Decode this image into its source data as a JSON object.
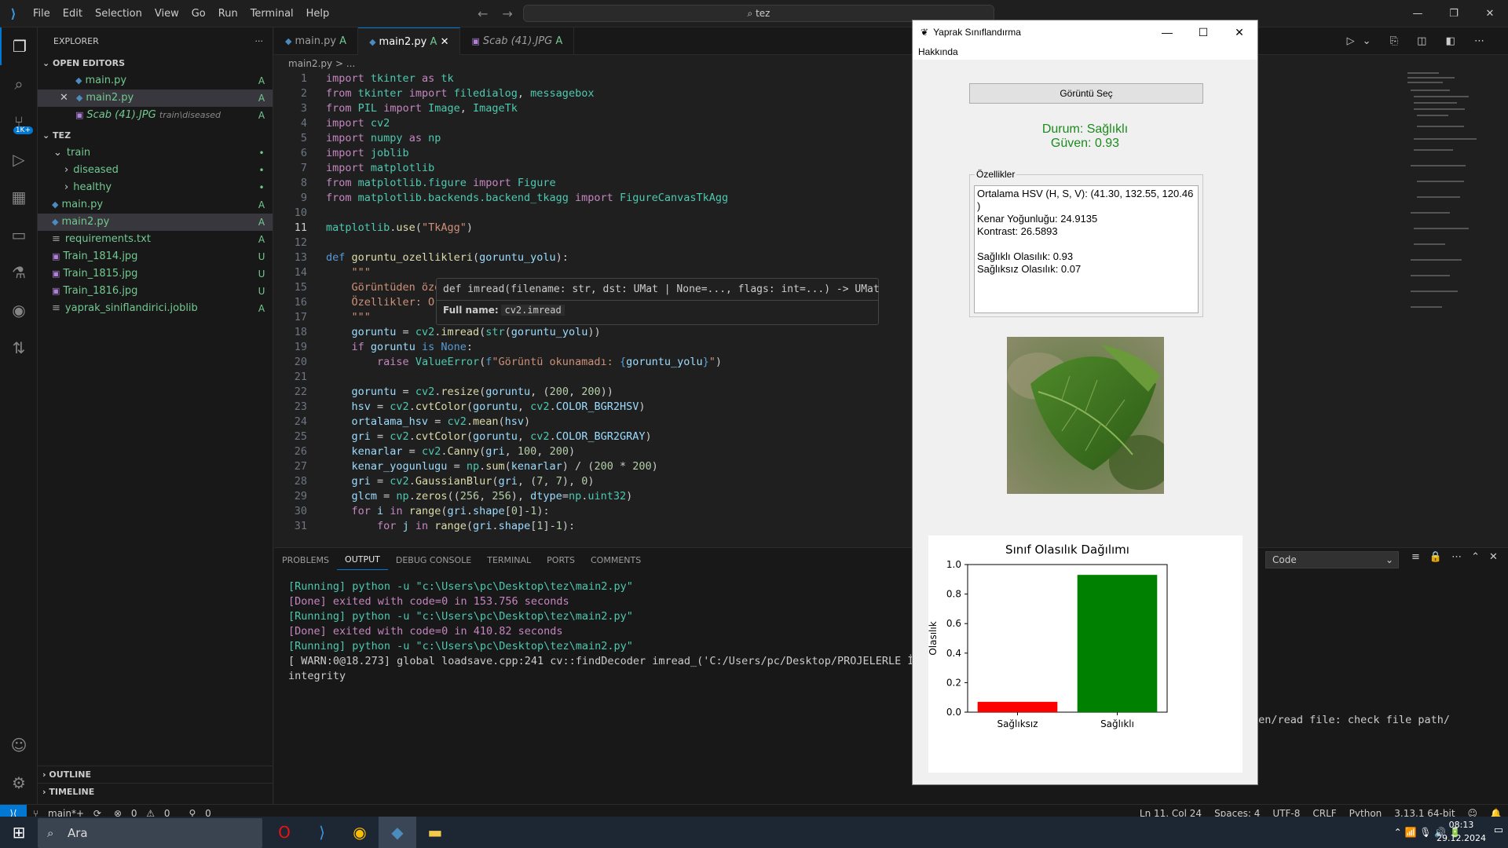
{
  "menu": [
    "File",
    "Edit",
    "Selection",
    "View",
    "Go",
    "Run",
    "Terminal",
    "Help"
  ],
  "search": "tez",
  "explorer": {
    "title": "EXPLORER",
    "open_editors": "OPEN EDITORS",
    "folder": "TEZ",
    "outline": "OUTLINE",
    "timeline": "TIMELINE",
    "open": [
      {
        "name": "main.py",
        "st": "A"
      },
      {
        "name": "main2.py",
        "st": "A"
      },
      {
        "name": "Scab (41).JPG",
        "path": "train\\diseased",
        "st": "A"
      }
    ],
    "tree": [
      {
        "name": "train",
        "st": "•"
      },
      {
        "name": "diseased",
        "st": "•"
      },
      {
        "name": "healthy",
        "st": "•"
      },
      {
        "name": "main.py",
        "st": "A"
      },
      {
        "name": "main2.py",
        "st": "A"
      },
      {
        "name": "requirements.txt",
        "st": "A"
      },
      {
        "name": "Train_1814.jpg",
        "st": "U"
      },
      {
        "name": "Train_1815.jpg",
        "st": "U"
      },
      {
        "name": "Train_1816.jpg",
        "st": "U"
      },
      {
        "name": "yaprak_siniflandirici.joblib",
        "st": "A"
      }
    ]
  },
  "tabs": [
    {
      "label": "main.py",
      "st": "A"
    },
    {
      "label": "main2.py",
      "st": "A"
    },
    {
      "label": "Scab (41).JPG",
      "st": "A"
    }
  ],
  "breadcrumb": "main2.py > ...",
  "hover": {
    "sig": "def imread(filename: str, dst: UMat | None=..., flags: int=...) -> UMat",
    "fullname_label": "Full name:",
    "fullname": "cv2.imread"
  },
  "panel": {
    "tabs": [
      "PROBLEMS",
      "OUTPUT",
      "DEBUG CONSOLE",
      "TERMINAL",
      "PORTS",
      "COMMENTS"
    ],
    "channel": "Code",
    "lines": [
      "[Running] python -u \"c:\\Users\\pc\\Desktop\\tez\\main2.py\"",
      "",
      "[Done] exited with code=0 in 153.756 seconds",
      "",
      "[Running] python -u \"c:\\Users\\pc\\Desktop\\tez\\main2.py\"",
      "",
      "[Done] exited with code=0 in 410.82 seconds",
      "",
      "[Running] python -u \"c:\\Users\\pc\\Desktop\\tez\\main2.py\"",
      "[ WARN:0@18.273] global loadsave.cpp:241 cv::findDecoder imread_('C:/Users/pc/Desktop/PROJELERLE İLGİLİ",
      "integrity"
    ],
    "tail": "pen/read file: check file path/"
  },
  "status": {
    "branch": "main*+",
    "errors": "0",
    "warnings": "0",
    "ports": "0",
    "pos": "Ln 11, Col 24",
    "spaces": "Spaces: 4",
    "enc": "UTF-8",
    "eol": "CRLF",
    "lang": "Python",
    "ver": "3.13.1 64-bit"
  },
  "taskbar": {
    "search": "Ara",
    "time": "08:13",
    "date": "29.12.2024"
  },
  "tk": {
    "title": "Yaprak Sınıflandırma",
    "menu": "Hakkında",
    "button": "Görüntü Seç",
    "status": "Durum: Sağlıklı",
    "confidence": "Güven: 0.93",
    "features_label": "Özellikler",
    "features": "Ortalama HSV (H, S, V): (41.30, 132.55, 120.46\n)\nKenar Yoğunluğu: 24.9135\nKontrast: 26.5893\n\nSağlıklı Olasılık: 0.93\nSağlıksız Olasılık: 0.07"
  },
  "chart_data": {
    "type": "bar",
    "title": "Sınıf Olasılık Dağılımı",
    "ylabel": "Olasılık",
    "xlabel": "",
    "categories": [
      "Sağlıksız",
      "Sağlıklı"
    ],
    "values": [
      0.07,
      0.93
    ],
    "colors": [
      "#ff0000",
      "#008000"
    ],
    "ylim": [
      0,
      1.0
    ],
    "yticks": [
      "0.0",
      "0.2",
      "0.4",
      "0.6",
      "0.8",
      "1.0"
    ],
    "grid": false
  }
}
